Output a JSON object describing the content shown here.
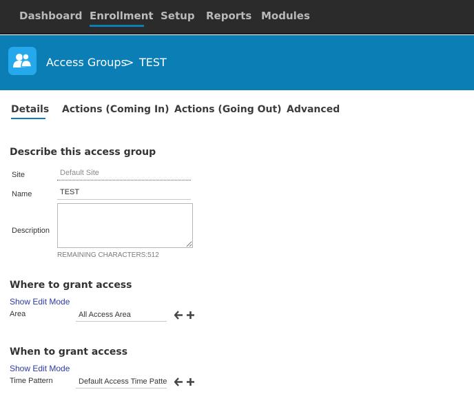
{
  "nav": {
    "items": [
      {
        "label": "Dashboard"
      },
      {
        "label": "Enrollment"
      },
      {
        "label": "Setup"
      },
      {
        "label": "Reports"
      },
      {
        "label": "Modules"
      }
    ],
    "active": "Enrollment"
  },
  "header": {
    "icon": "users-icon",
    "breadcrumb": {
      "parent": "Access Groups",
      "separator": ">",
      "current": "TEST"
    }
  },
  "tabs": [
    {
      "label": "Details"
    },
    {
      "label": "Actions (Coming In)"
    },
    {
      "label": "Actions (Going Out)"
    },
    {
      "label": "Advanced"
    }
  ],
  "describe": {
    "heading": "Describe this access group",
    "site_label": "Site",
    "site_value": "Default Site",
    "name_label": "Name",
    "name_value": "TEST",
    "description_label": "Description",
    "description_value": "",
    "remaining": "REMAINING CHARACTERS:512"
  },
  "where": {
    "heading": "Where to grant access",
    "edit_link": "Show Edit Mode",
    "area_label": "Area",
    "area_value": "All Access Area"
  },
  "when": {
    "heading": "When to grant access",
    "edit_link": "Show Edit Mode",
    "time_label": "Time Pattern",
    "time_value": "Default Access Time Pattern"
  },
  "colors": {
    "nav_bg": "#2b2b2b",
    "accent": "#0a7eb5",
    "icon_bg": "#26a9ec",
    "link": "#2b3aa0"
  }
}
